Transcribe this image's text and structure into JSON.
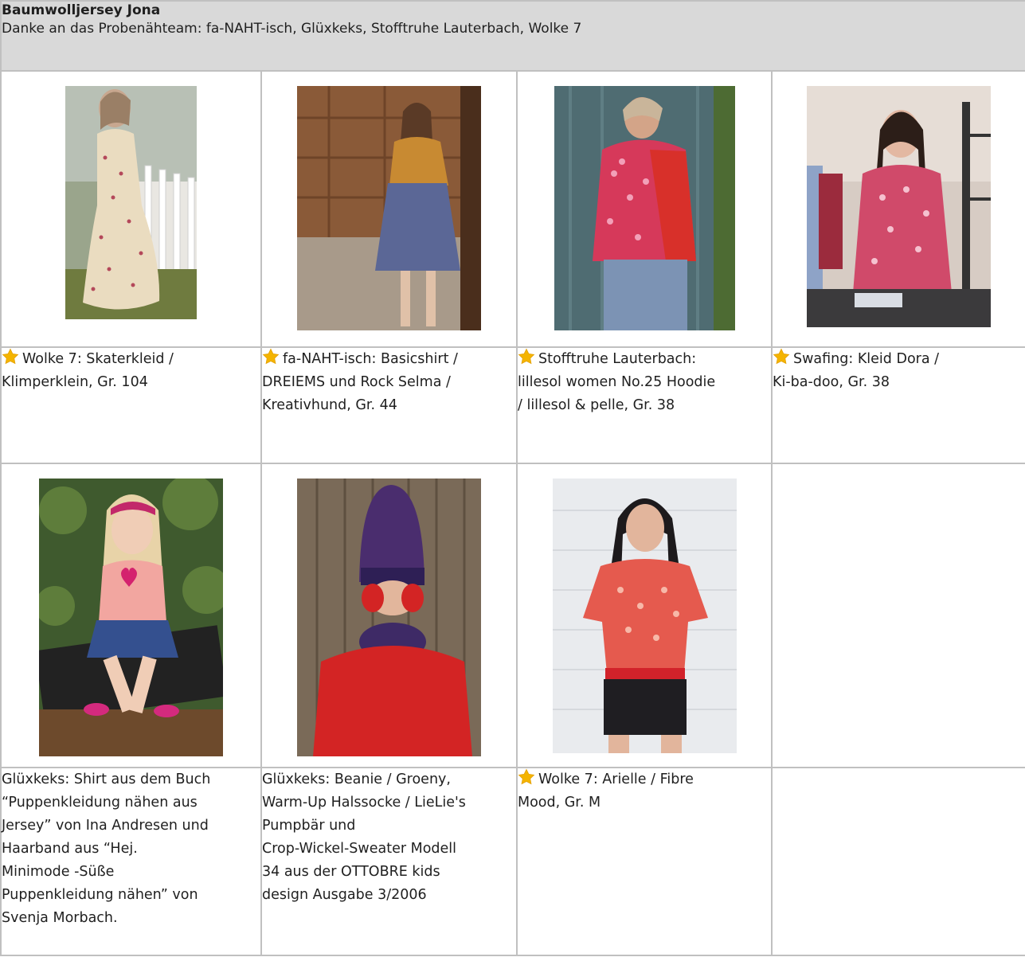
{
  "header": {
    "title": "Baumwolljersey Jona",
    "subtitle": "Danke an das Probenähteam: fa-NAHT-isch, Glüxkeks, Stofftruhe Lauterbach, Wolke 7"
  },
  "star_color": "#f4b400",
  "row1": [
    {
      "photo": "girl-in-floral-skater-dress-photo",
      "starred": true,
      "caption": "Wolke 7: Skaterkleid /\nKlimperklein, Gr. 104"
    },
    {
      "photo": "woman-in-mustard-top-and-blue-skirt-photo",
      "starred": true,
      "caption": "fa-NAHT-isch: Basicshirt /\nDREIEMS und Rock Selma /\nKreativhund, Gr. 44"
    },
    {
      "photo": "woman-in-floral-hoodie-photo",
      "starred": true,
      "caption": "Stofftruhe Lauterbach:\nlillesol women No.25 Hoodie\n/ lillesol & pelle, Gr. 38"
    },
    {
      "photo": "woman-in-floral-dress-shop-photo",
      "starred": true,
      "caption": "Swafing: Kleid Dora /\nKi-ba-doo, Gr. 38"
    }
  ],
  "row2": [
    {
      "photo": "doll-in-shirt-and-skirt-photo",
      "starred": false,
      "caption": "Glüxkeks: Shirt aus dem Buch\n“Puppenkleidung nähen aus\nJersey” von Ina Andresen und\nHaarband aus “Hej.\nMinimode -Süße\nPuppenkleidung nähen” von\nSvenja Morbach."
    },
    {
      "photo": "child-in-beanie-and-red-sweater-photo",
      "starred": false,
      "caption": "Glüxkeks: Beanie / Groeny,\nWarm-Up Halssocke / LieLie's\nPumpbär und\nCrop-Wickel-Sweater Modell\n34 aus der OTTOBRE kids\ndesign Ausgabe 3/2006"
    },
    {
      "photo": "woman-in-floral-puff-sleeve-top-photo",
      "starred": true,
      "caption": "Wolke 7: Arielle / Fibre\nMood, Gr. M"
    },
    {
      "photo": "",
      "starred": false,
      "caption": ""
    }
  ]
}
